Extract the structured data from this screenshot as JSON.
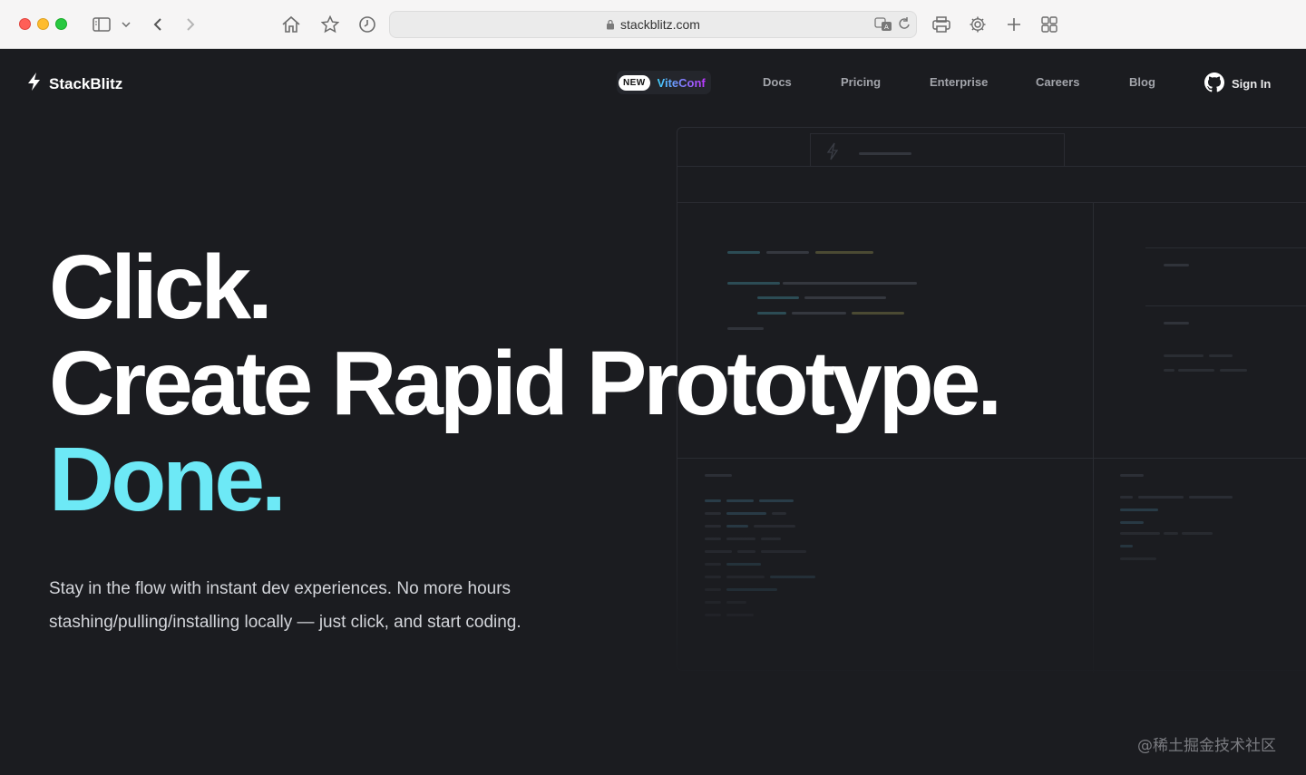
{
  "browser": {
    "url": "stackblitz.com"
  },
  "nav": {
    "brand": "StackBlitz",
    "badge": "NEW",
    "vite_label": "ViteConf",
    "items": [
      "Docs",
      "Pricing",
      "Enterprise",
      "Careers",
      "Blog"
    ],
    "signin": "Sign In"
  },
  "hero": {
    "line1": "Click.",
    "line2": "Create Rapid Prototype.",
    "line3": "Done.",
    "subtitle_line1": "Stay in the flow with instant dev experiences. No more hours",
    "subtitle_line2": "stashing/pulling/installing locally — just click, and start coding."
  },
  "watermark": "@稀土掘金技术社区",
  "colors": {
    "background": "#1b1c20",
    "accent": "#6de9f6",
    "text": "#ffffff"
  }
}
